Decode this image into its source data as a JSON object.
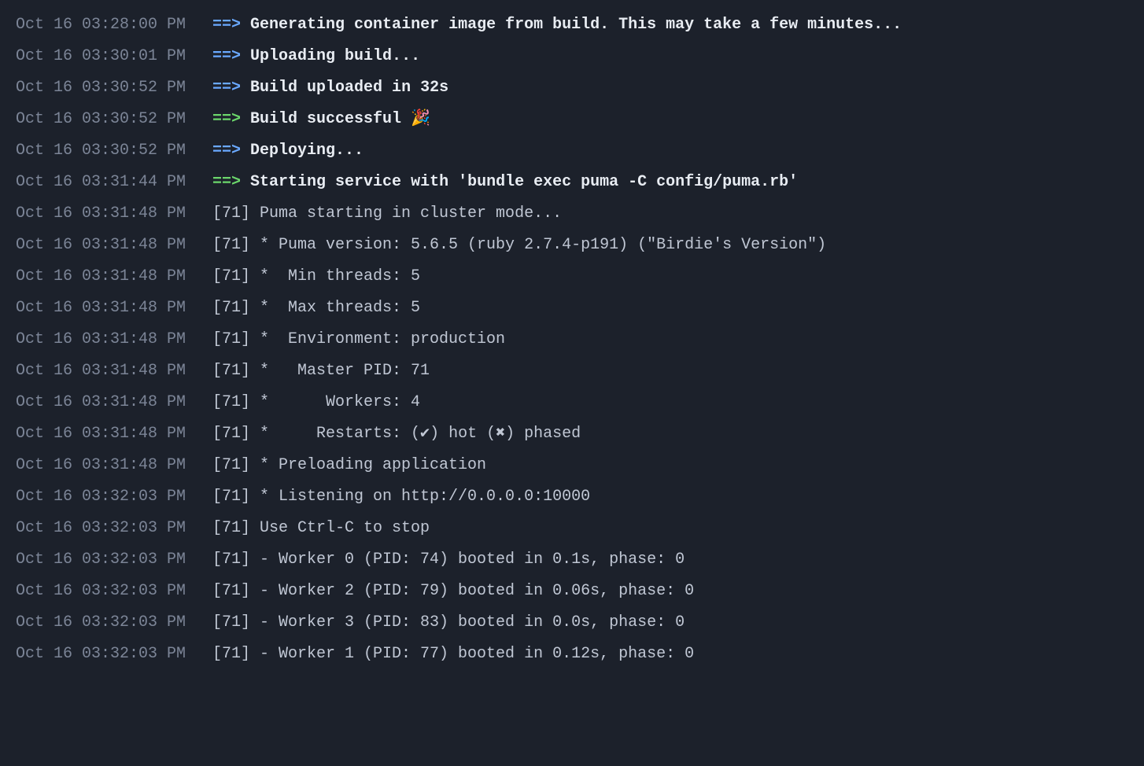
{
  "colors": {
    "background": "#1c212b",
    "timestamp": "#7c8597",
    "plain": "#c0c7d4",
    "bold": "#e8ecf2",
    "arrow_blue": "#6aa9ff",
    "arrow_green": "#6bd66b"
  },
  "arrow_glyph": "==>",
  "logs": [
    {
      "ts": "Oct 16 03:28:00 PM",
      "arrow": "blue",
      "bold": true,
      "msg": "Generating container image from build. This may take a few minutes..."
    },
    {
      "ts": "Oct 16 03:30:01 PM",
      "arrow": "blue",
      "bold": true,
      "msg": "Uploading build..."
    },
    {
      "ts": "Oct 16 03:30:52 PM",
      "arrow": "blue",
      "bold": true,
      "msg": "Build uploaded in 32s"
    },
    {
      "ts": "Oct 16 03:30:52 PM",
      "arrow": "green",
      "bold": true,
      "msg": "Build successful 🎉"
    },
    {
      "ts": "Oct 16 03:30:52 PM",
      "arrow": "blue",
      "bold": true,
      "msg": "Deploying..."
    },
    {
      "ts": "Oct 16 03:31:44 PM",
      "arrow": "green",
      "bold": true,
      "msg": "Starting service with 'bundle exec puma -C config/puma.rb'"
    },
    {
      "ts": "Oct 16 03:31:48 PM",
      "arrow": "none",
      "bold": false,
      "msg": "[71] Puma starting in cluster mode..."
    },
    {
      "ts": "Oct 16 03:31:48 PM",
      "arrow": "none",
      "bold": false,
      "msg": "[71] * Puma version: 5.6.5 (ruby 2.7.4-p191) (\"Birdie's Version\")"
    },
    {
      "ts": "Oct 16 03:31:48 PM",
      "arrow": "none",
      "bold": false,
      "msg": "[71] *  Min threads: 5"
    },
    {
      "ts": "Oct 16 03:31:48 PM",
      "arrow": "none",
      "bold": false,
      "msg": "[71] *  Max threads: 5"
    },
    {
      "ts": "Oct 16 03:31:48 PM",
      "arrow": "none",
      "bold": false,
      "msg": "[71] *  Environment: production"
    },
    {
      "ts": "Oct 16 03:31:48 PM",
      "arrow": "none",
      "bold": false,
      "msg": "[71] *   Master PID: 71"
    },
    {
      "ts": "Oct 16 03:31:48 PM",
      "arrow": "none",
      "bold": false,
      "msg": "[71] *      Workers: 4"
    },
    {
      "ts": "Oct 16 03:31:48 PM",
      "arrow": "none",
      "bold": false,
      "msg": "[71] *     Restarts: (✔) hot (✖) phased"
    },
    {
      "ts": "Oct 16 03:31:48 PM",
      "arrow": "none",
      "bold": false,
      "msg": "[71] * Preloading application"
    },
    {
      "ts": "Oct 16 03:32:03 PM",
      "arrow": "none",
      "bold": false,
      "msg": "[71] * Listening on http://0.0.0.0:10000"
    },
    {
      "ts": "Oct 16 03:32:03 PM",
      "arrow": "none",
      "bold": false,
      "msg": "[71] Use Ctrl-C to stop"
    },
    {
      "ts": "Oct 16 03:32:03 PM",
      "arrow": "none",
      "bold": false,
      "msg": "[71] - Worker 0 (PID: 74) booted in 0.1s, phase: 0"
    },
    {
      "ts": "Oct 16 03:32:03 PM",
      "arrow": "none",
      "bold": false,
      "msg": "[71] - Worker 2 (PID: 79) booted in 0.06s, phase: 0"
    },
    {
      "ts": "Oct 16 03:32:03 PM",
      "arrow": "none",
      "bold": false,
      "msg": "[71] - Worker 3 (PID: 83) booted in 0.0s, phase: 0"
    },
    {
      "ts": "Oct 16 03:32:03 PM",
      "arrow": "none",
      "bold": false,
      "msg": "[71] - Worker 1 (PID: 77) booted in 0.12s, phase: 0"
    }
  ]
}
